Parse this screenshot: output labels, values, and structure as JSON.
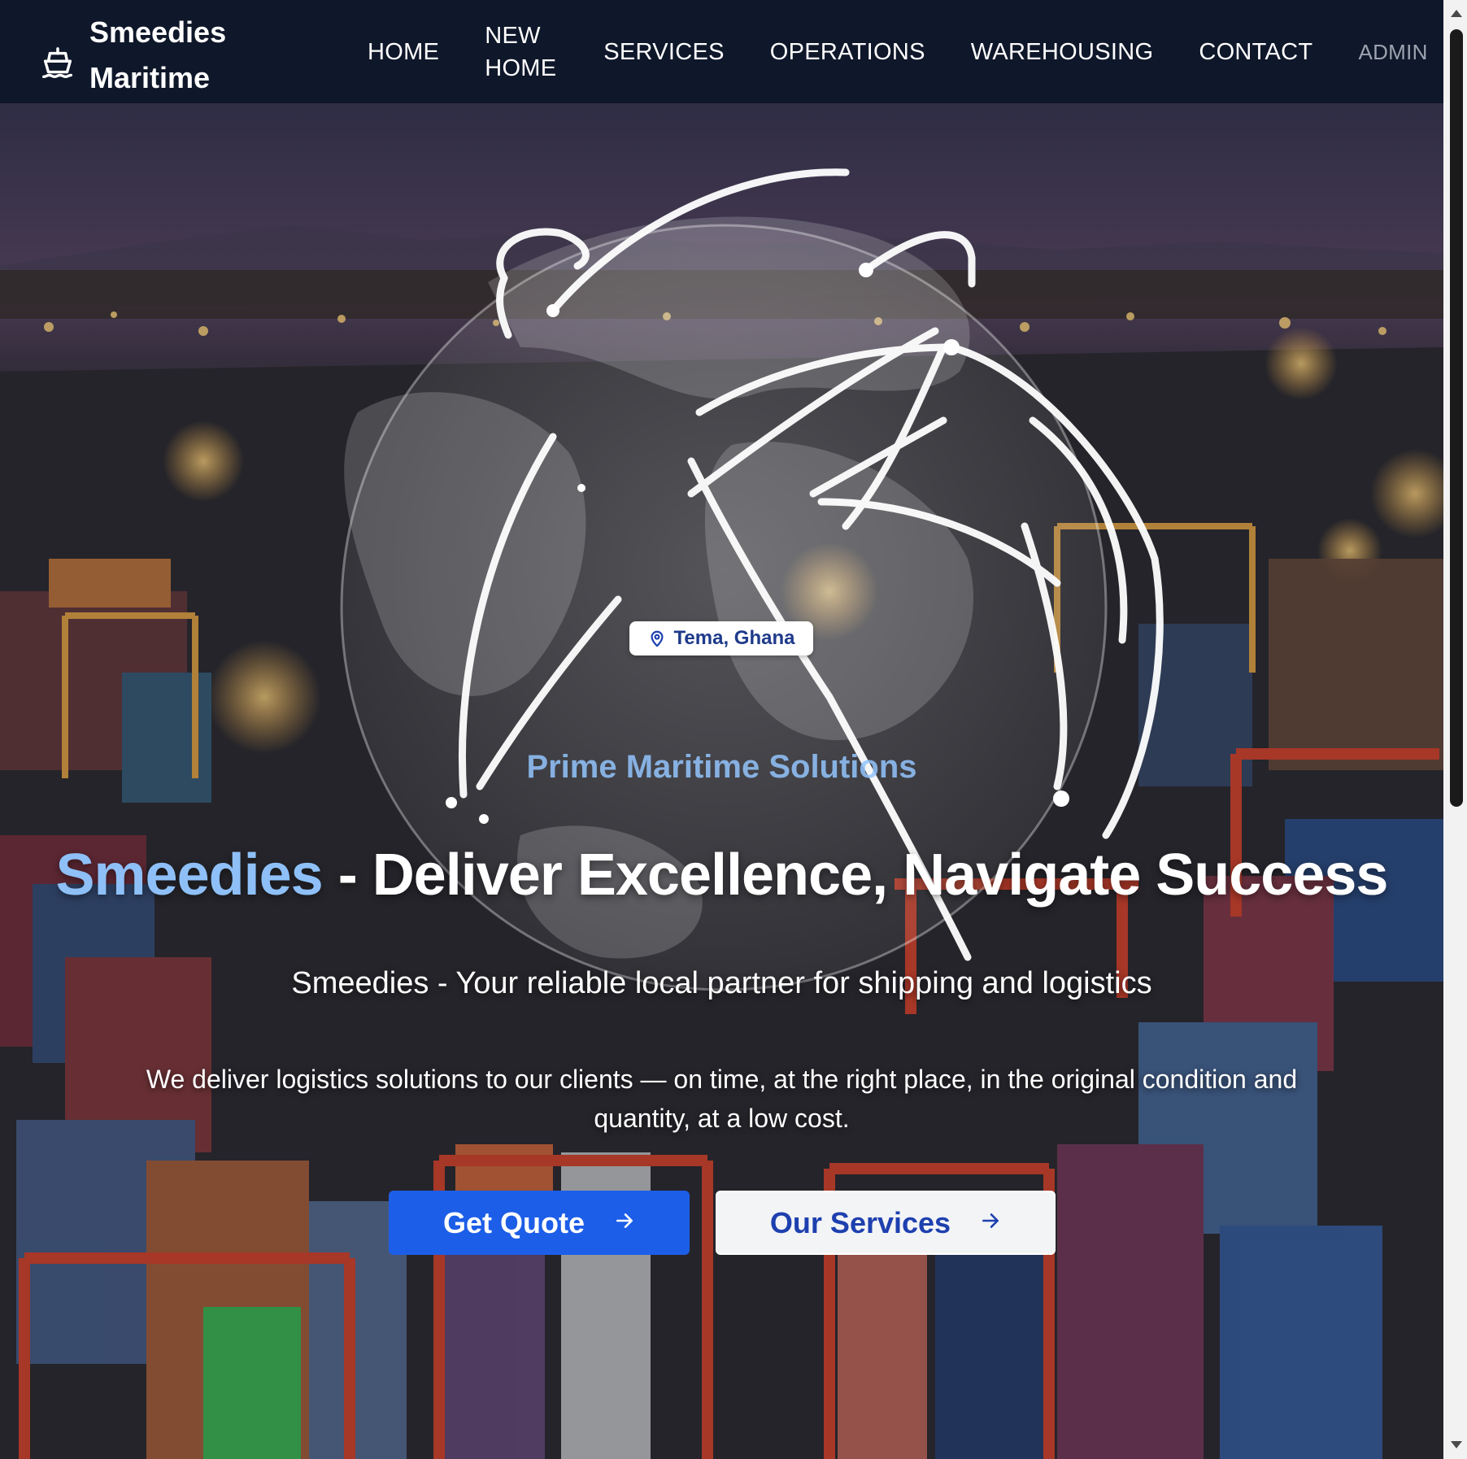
{
  "brand": {
    "name_line1": "Smeedies",
    "name_line2": "Maritime",
    "icon": "ship-icon"
  },
  "nav": {
    "items": [
      {
        "label": "HOME"
      },
      {
        "label_line1": "NEW",
        "label_line2": "HOME"
      },
      {
        "label": "SERVICES"
      },
      {
        "label": "OPERATIONS"
      },
      {
        "label": "WAREHOUSING"
      },
      {
        "label": "CONTACT"
      },
      {
        "label": "ADMIN"
      }
    ]
  },
  "hero": {
    "background": "night-container-port-with-globe-overlay",
    "location": "Tema, Ghana",
    "location_icon": "map-pin-icon",
    "tagline": "Prime Maritime Solutions",
    "headline_accent": "Smeedies",
    "headline_rest": " - Deliver Excellence, Navigate Success",
    "subheadline": "Smeedies - Your reliable local partner for shipping and logistics",
    "description": "We deliver logistics solutions to our clients — on time, at the right place, in the original condition and quantity, at a low cost.",
    "buttons": {
      "quote": "Get Quote",
      "services": "Our Services",
      "arrow_icon": "arrow-right-icon"
    }
  },
  "colors": {
    "navbar_bg": "#0f172a",
    "accent_blue": "#1d5ee8",
    "headline_accent": "#8ec0f7",
    "tagline": "#93c5fd"
  }
}
